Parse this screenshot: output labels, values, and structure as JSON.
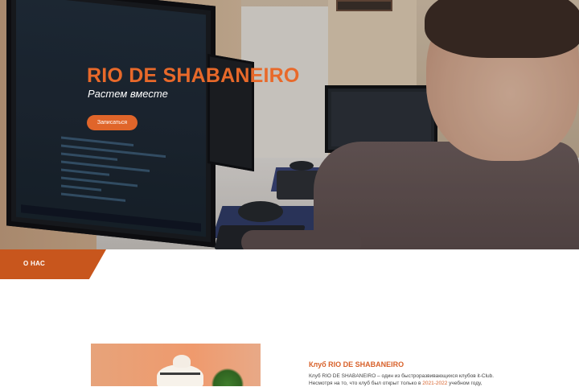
{
  "hero": {
    "title": "RIO DE SHABANEIRO",
    "subtitle": "Растем вместе",
    "cta_label": "Записаться"
  },
  "about_section": {
    "label": "О НАС",
    "heading": "Клуб RIO DE SHABANEIRO",
    "text_line1": "Клуб RIO DE SHABANEIRO – один из быстроразвивающихся клубов it-Club.",
    "text_line2_start": "Несмотря на то, что клуб был открыт только в ",
    "text_line2_highlight": "2021-2022",
    "text_line2_end": " учебном году,"
  },
  "colors": {
    "accent": "#e0652a",
    "section_tab": "#c8561d",
    "text": "#444444"
  }
}
